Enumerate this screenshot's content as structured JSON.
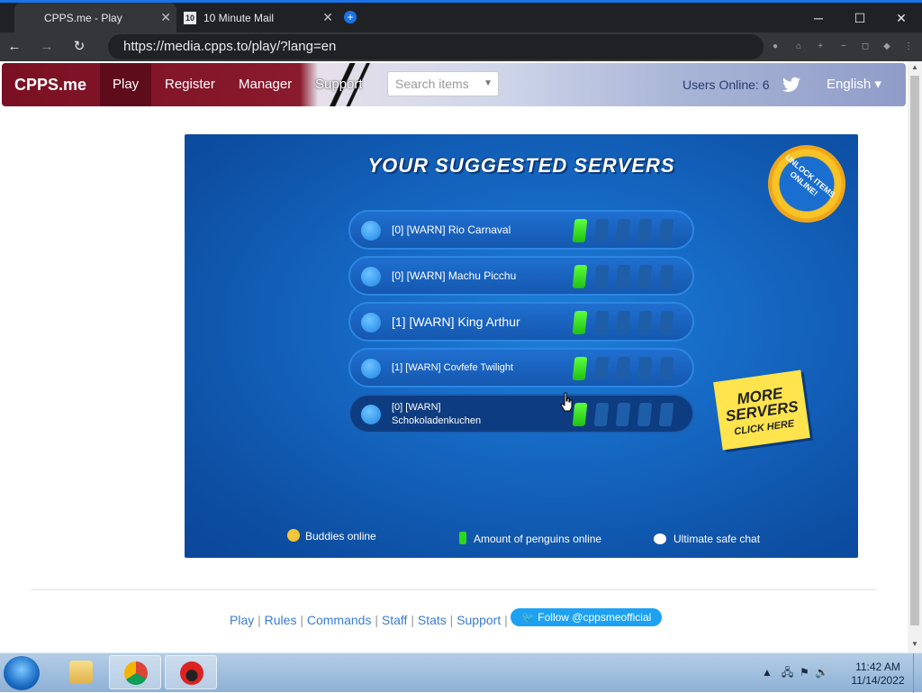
{
  "browser": {
    "tabs": [
      {
        "title": "CPPS.me - Play",
        "active": true
      },
      {
        "title": "10 Minute Mail",
        "active": false,
        "favicon_text": "10"
      }
    ],
    "url": "https://media.cpps.to/play/?lang=en",
    "window_controls": {
      "minimize": "─",
      "maximize": "☐",
      "close": "✕"
    }
  },
  "site": {
    "brand": "CPPS.me",
    "nav": [
      "Play",
      "Register",
      "Manager",
      "Support"
    ],
    "search_placeholder": "Search items",
    "users_online": "Users Online: 6",
    "language": "English ▾"
  },
  "game": {
    "title": "YOUR SUGGESTED SERVERS",
    "badge": "UNLOCK ITEMS ONLINE!",
    "servers": [
      {
        "name": "[0] [WARN] Rio Carnaval",
        "load": 1,
        "bars": 5
      },
      {
        "name": "[0] [WARN] Machu Picchu",
        "load": 1,
        "bars": 5
      },
      {
        "name": "[1] [WARN] King Arthur",
        "load": 1,
        "bars": 5
      },
      {
        "name": "[1] [WARN] Covfefe Twilight",
        "load": 1,
        "bars": 5
      },
      {
        "name": "[0] [WARN] Schokoladenkuchen",
        "load": 1,
        "bars": 5
      }
    ],
    "more_servers": {
      "line1": "MORE",
      "line2": "SERVERS",
      "line3": "CLICK HERE"
    },
    "legend": {
      "buddies": "Buddies online",
      "penguins": "Amount of penguins online",
      "safechat": "Ultimate safe chat"
    }
  },
  "footer": {
    "links": [
      "Play",
      "Rules",
      "Commands",
      "Staff",
      "Stats",
      "Support"
    ],
    "separator": "|",
    "twitter_button": "Follow @cppsmeofficial"
  },
  "taskbar": {
    "time": "11:42 AM",
    "date": "11/14/2022",
    "tray_arrow": "▲"
  },
  "colors": {
    "site_brand_bg": "#7a1023",
    "game_bg": "#1567c2",
    "bar_on": "#2cd81c",
    "link": "#3a7bd5",
    "twitter": "#1da1f2"
  }
}
